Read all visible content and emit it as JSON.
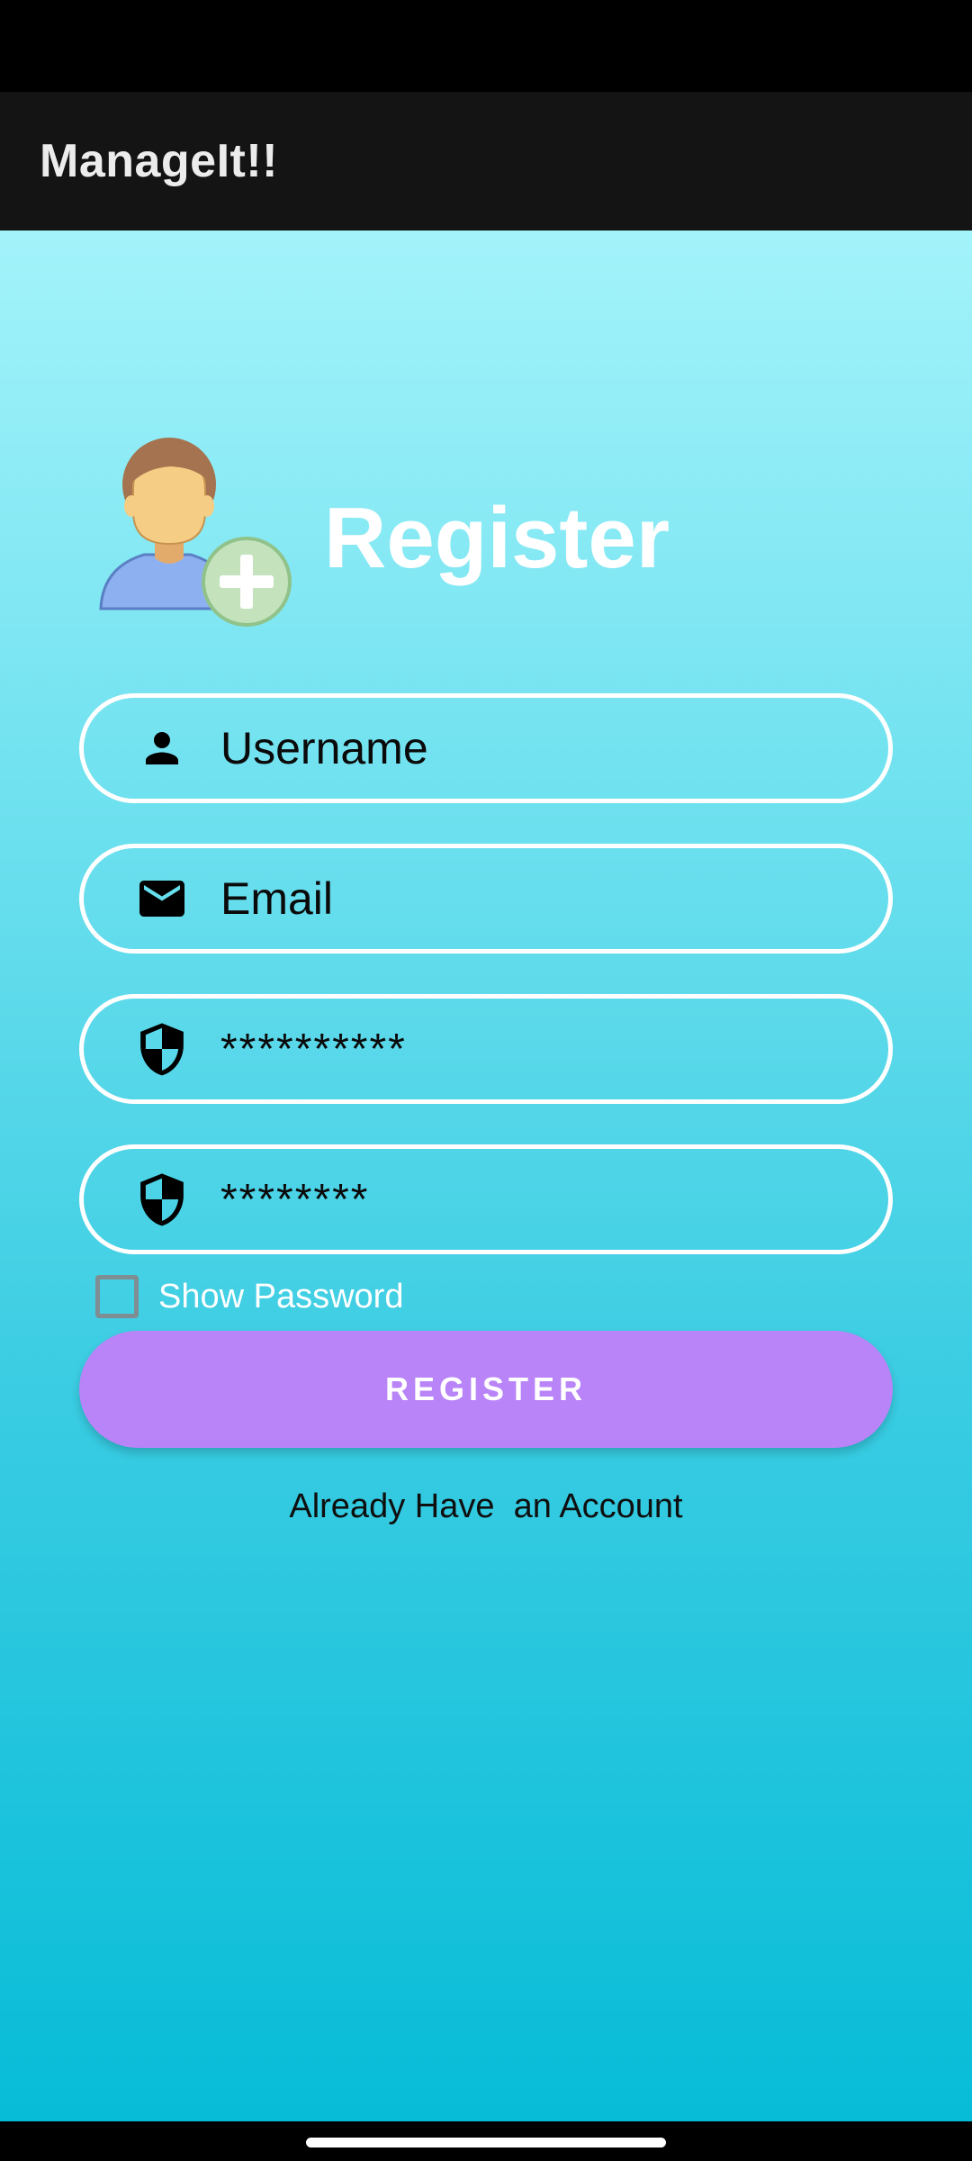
{
  "app_bar": {
    "title": "ManageIt!!"
  },
  "header": {
    "title": "Register",
    "icon": "add-user-icon"
  },
  "form": {
    "username": {
      "value": "Username",
      "icon": "person-icon"
    },
    "email": {
      "value": "Email",
      "icon": "mail-icon"
    },
    "password": {
      "value": "**********",
      "icon": "shield-icon"
    },
    "confirm_password": {
      "value": "********",
      "icon": "shield-icon"
    },
    "show_password": {
      "label": "Show Password",
      "checked": false
    },
    "register_button": {
      "label": "REGISTER"
    },
    "login_link": "Already Have  an Account"
  },
  "colors": {
    "gradient_top": "#a3f3fa",
    "gradient_bottom": "#07bcd7",
    "button": "#b884f7",
    "app_bar": "#141414"
  }
}
